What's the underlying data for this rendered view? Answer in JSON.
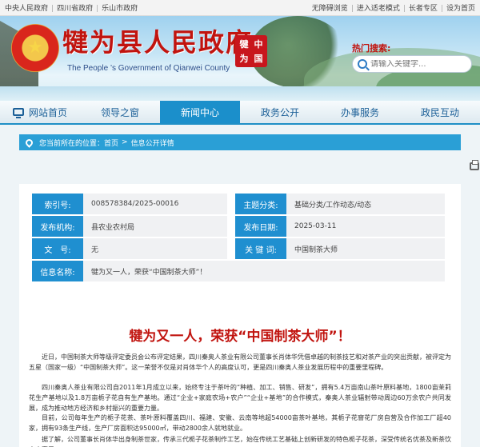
{
  "topbar": {
    "links": [
      "中央人民政府",
      "四川省政府",
      "乐山市政府"
    ],
    "tools": [
      "无障碍浏览",
      "进入适老模式",
      "长者专区",
      "设为首页"
    ]
  },
  "header": {
    "title": "犍为县人民政府",
    "subtitle": "The People ’s Government of Qianwei County",
    "seal_chars": [
      "犍",
      "中",
      "为",
      "国"
    ],
    "search_label": "热门搜索:",
    "search_placeholder": "请输入关键字..."
  },
  "nav": {
    "items": [
      {
        "label": "网站首页"
      },
      {
        "label": "领导之窗"
      },
      {
        "label": "新闻中心"
      },
      {
        "label": "政务公开"
      },
      {
        "label": "办事服务"
      },
      {
        "label": "政民互动"
      }
    ],
    "active_index": 2
  },
  "breadcrumb": {
    "prefix": "您当前所在的位置：",
    "home": "首页",
    "arrow": ">",
    "current": "信息公开详情"
  },
  "meta": {
    "index_label": "索引号:",
    "index_value": "008578384/2025-00016",
    "category_label": "主题分类:",
    "category_value": "基础分类/工作动态/动态",
    "publisher_label": "发布机构:",
    "publisher_value": "县农业农村局",
    "date_label": "发布日期:",
    "date_value": "2025-03-11",
    "docno_label": "文　号:",
    "docno_value": "无",
    "keyword_label": "关 键 词:",
    "keyword_value": "中国制茶大师",
    "name_label": "信息名称:",
    "name_value": "犍为又一人，荣获“中国制茶大师”！"
  },
  "article": {
    "title": "犍为又一人，荣获“中国制茶大师”！",
    "paragraphs": [
      "近日，中国制茶大师等级评定委员会公布评定结果，四川秦奥人茶业有限公司董事长肖体华凭借卓越的制茶技艺和对茶产业的突出贡献，被评定为五星（国家一级）“中国制茶大师”。这一荣誉不仅是对肖体华个人的高度认可，更是四川秦奥人茶业发展历程中的重要里程碑。",
      "四川秦奥人茶业有限公司自2011年1月成立以来，始终专注于茶叶的“种植、加工、销售、研发”，拥有5.4万亩南山茶叶原料基地，1800亩茉莉花生产基地以及1.8万亩栀子花自有生产基地。通过“企业+家庭农场+农户”“企业+基地”的合作模式，秦奥人茶业辐射带动周边60万余农户共同发展，成为推动地方经济和乡村振兴的重要力量。",
      "目前，公司每年生产的栀子花茶、茶叶原料覆盖四川、福建、安徽、云南等地超54000亩茶叶基地，其栀子花窨花厂房自营及合作加工厂超40家，拥有93条生产线，生产厂房面积达95000㎡，带动2800余人就地就业。",
      "据了解，公司董事长肖体华出身制茶世家，传承三代栀子花茶制作工艺，始在传统工艺基础上创新研发的特色栀子花茶，深受传统名优茶及新茶饮客户喜爱。"
    ]
  }
}
